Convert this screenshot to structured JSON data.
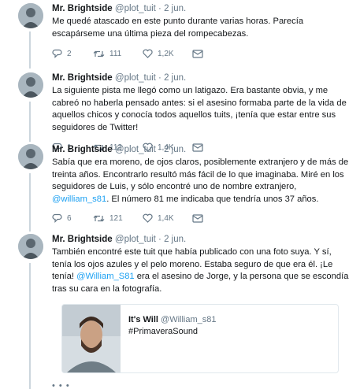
{
  "tweets": [
    {
      "name": "Mr. Brightside",
      "handle": "@plot_tuit",
      "separator": "·",
      "date": "2 jun.",
      "text": "Me quedé atascado en este punto durante varias horas. Parecía escapárseme una última pieza del rompecabezas.",
      "replies": "2",
      "retweets": "111",
      "likes": "1,2K"
    },
    {
      "name": "Mr. Brightside",
      "handle": "@plot_tuit",
      "separator": "·",
      "date": "2 jun.",
      "text": "La siguiente pista me llegó como un latigazo. Era bastante obvia, y me cabreó no haberla pensado antes: si el asesino formaba parte de la vida de aquellos chicos y conocía todos aquellos tuits, ¡tenía que estar entre sus seguidores de Twitter!",
      "replies": "1",
      "retweets": "112",
      "likes": "1,4K"
    },
    {
      "name": "Mr. Brightside",
      "handle": "@plot_tuit",
      "separator": "·",
      "date": "2 jun.",
      "text_before": "Sabía que era moreno, de ojos claros, posiblemente extranjero y de más de treinta años. Encontrarlo resultó más fácil de lo que imaginaba. Miré en los seguidores de Luis, y sólo encontré uno de nombre extranjero, ",
      "mention": "@william_s81",
      "text_after": ". El número 81 me indicaba que tendría unos 37 años.",
      "replies": "6",
      "retweets": "121",
      "likes": "1,4K"
    },
    {
      "name": "Mr. Brightside",
      "handle": "@plot_tuit",
      "separator": "·",
      "date": "2 jun.",
      "text_before": "También encontré este tuit que había publicado con una foto suya. Y sí, tenía los ojos azules y el pelo moreno. Estaba seguro de que era él. ¡Le tenía! ",
      "mention": "@William_S81",
      "text_after": " era el asesino de Jorge, y la persona que se escondía tras su cara en la fotografía.",
      "quoted": {
        "name": "It's Will",
        "handle": "@William_s81",
        "text": "#PrimaveraSound"
      }
    }
  ],
  "icons": {
    "reply": "reply-icon",
    "retweet": "retweet-icon",
    "like": "heart-icon",
    "dm": "envelope-icon"
  },
  "colors": {
    "accent": "#1da1f2",
    "secondary_text": "#657786",
    "primary_text": "#14171a",
    "thread_line": "#ccd6dd"
  }
}
